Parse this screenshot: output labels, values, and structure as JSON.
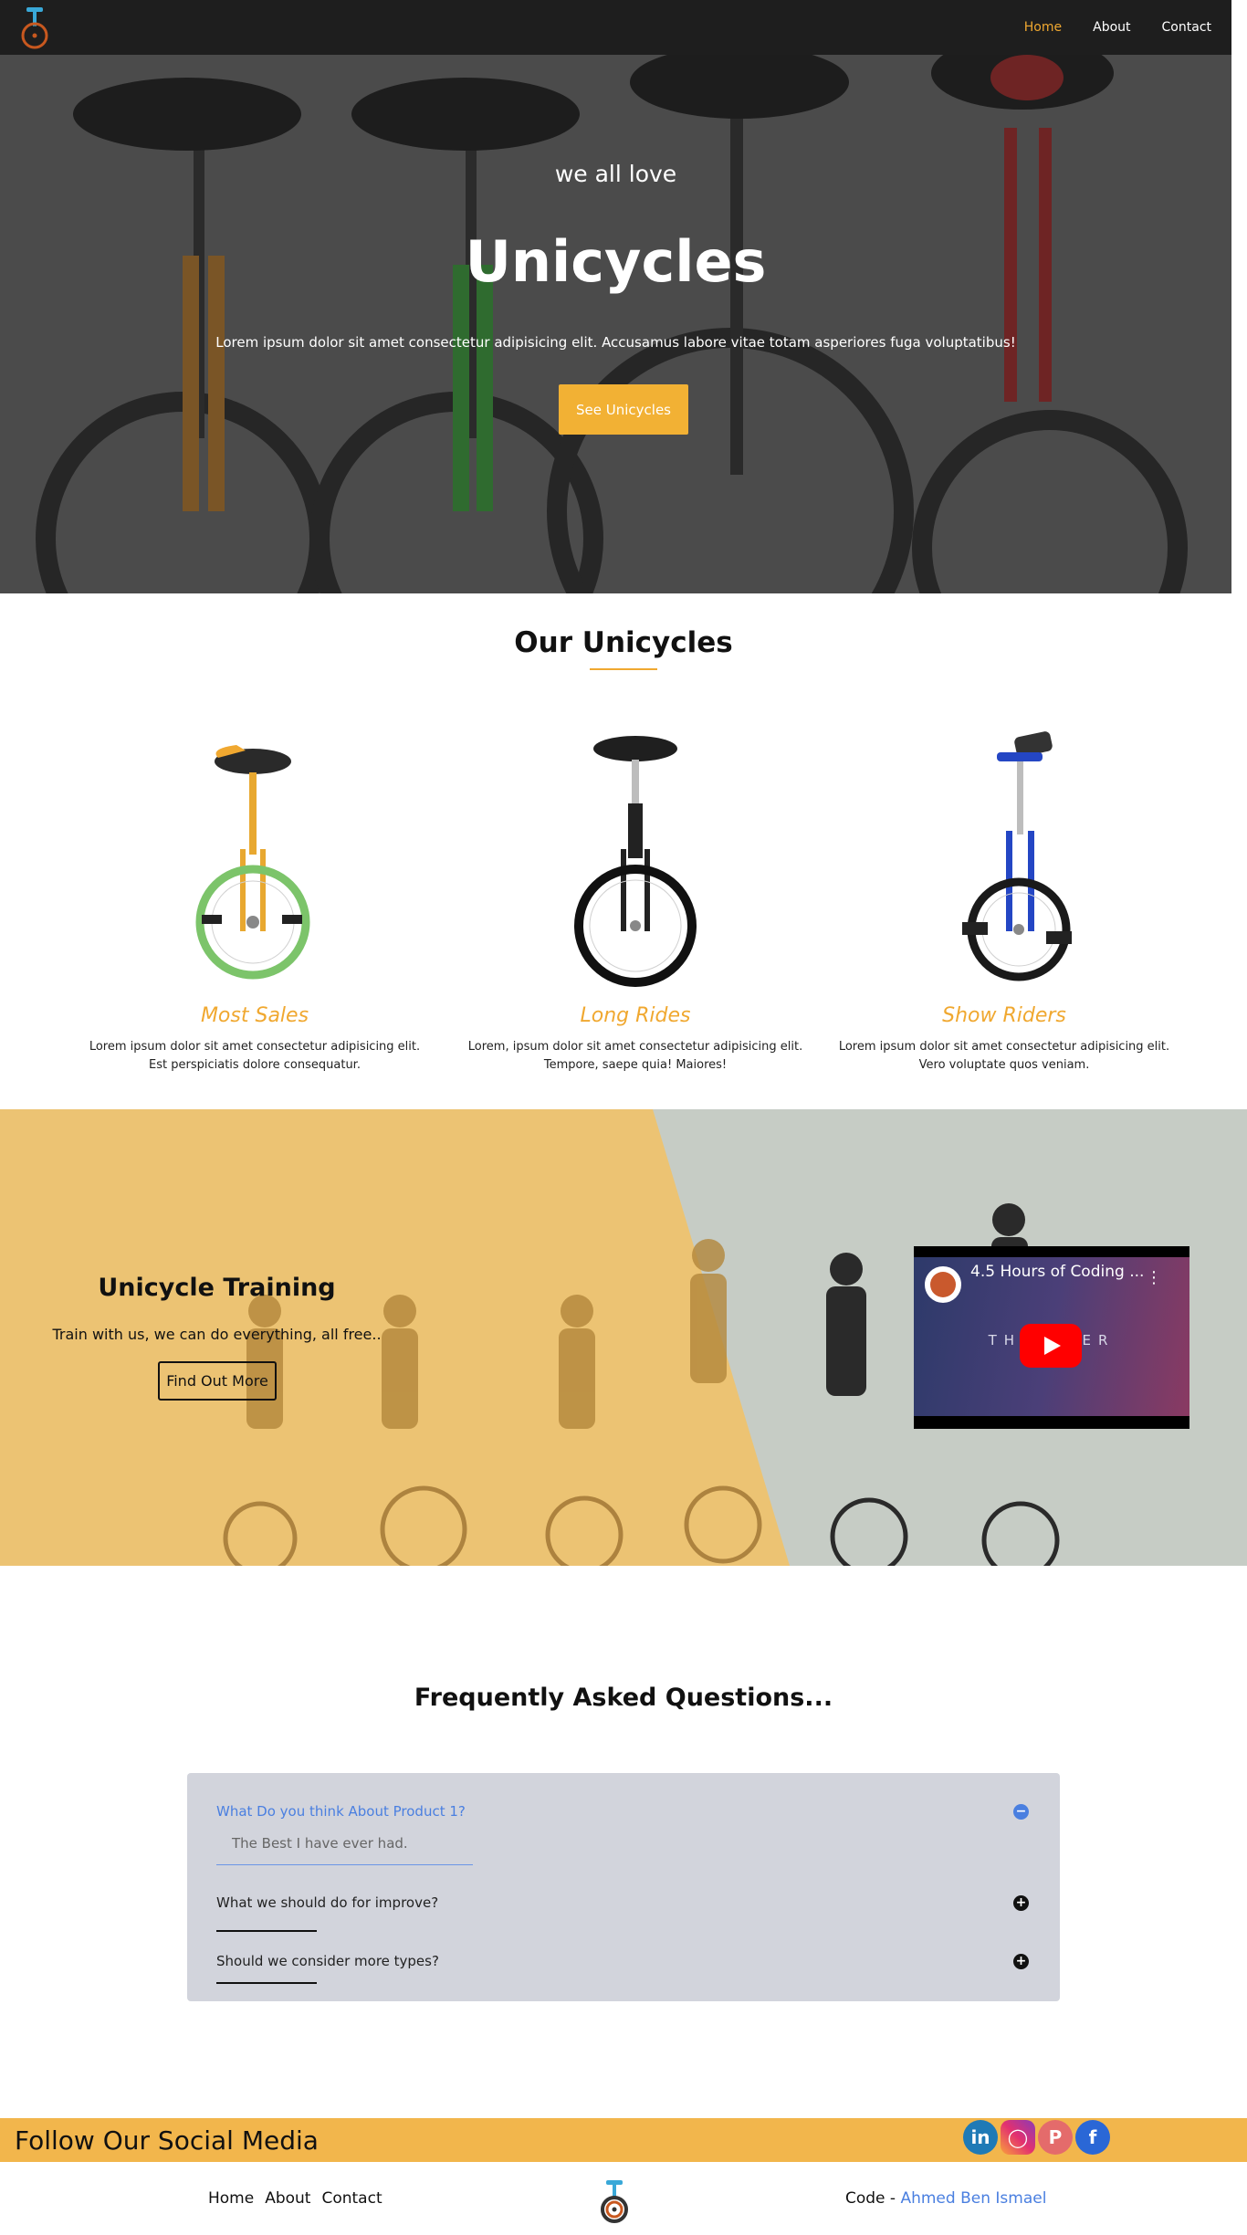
{
  "nav": {
    "logo_icon": "unicycle-icon",
    "links": [
      "Home",
      "About",
      "Contact"
    ],
    "active": "Home"
  },
  "hero": {
    "tagline": "we all love",
    "title": "Unicycles",
    "description": "Lorem ipsum dolor sit amet consectetur adipisicing elit. Accusamus labore vitae totam asperiores fuga voluptatibus!",
    "button": "See Unicycles"
  },
  "unicycles": {
    "title": "Our Unicycles",
    "cards": [
      {
        "title": "Most Sales",
        "text": "Lorem ipsum dolor sit amet consectetur adipisicing elit. Est perspiciatis dolore consequatur.",
        "color": "#f0a830"
      },
      {
        "title": "Long Rides",
        "text": "Lorem, ipsum dolor sit amet consectetur adipisicing elit. Tempore, saepe quia! Maiores!",
        "color": "#f0a830"
      },
      {
        "title": "Show Riders",
        "text": "Lorem ipsum dolor sit amet consectetur adipisicing elit. Vero voluptate quos veniam.",
        "color": "#f0a830"
      }
    ]
  },
  "training": {
    "title": "Unicycle Training",
    "text": "Train with us, we can do everything, all free..",
    "button": "Find Out More",
    "video": {
      "title": "4.5 Hours of Coding ...",
      "brand": "THE  RKER",
      "play_icon": "youtube-play-icon",
      "menu_icon": "more-vert-icon"
    }
  },
  "faq": {
    "title": "Frequently Asked Questions...",
    "items": [
      {
        "question": "What Do you think About Product 1?",
        "answer": "The Best I have ever had.",
        "open": true
      },
      {
        "question": "What we should do for improve?",
        "open": false
      },
      {
        "question": "Should we consider more types?",
        "open": false
      }
    ]
  },
  "social": {
    "title": "Follow Our Social Media",
    "icons": [
      "linkedin-icon",
      "instagram-icon",
      "pinterest-icon",
      "facebook-icon"
    ]
  },
  "footer": {
    "links": [
      "Home",
      "About",
      "Contact"
    ],
    "code_label": "Code -",
    "author": "Ahmed Ben Ismael"
  },
  "colors": {
    "accent": "#f0a830",
    "nav_bg": "#1e1e1e",
    "faq_bg": "#d2d4dc",
    "link_blue": "#4a7fe0"
  }
}
